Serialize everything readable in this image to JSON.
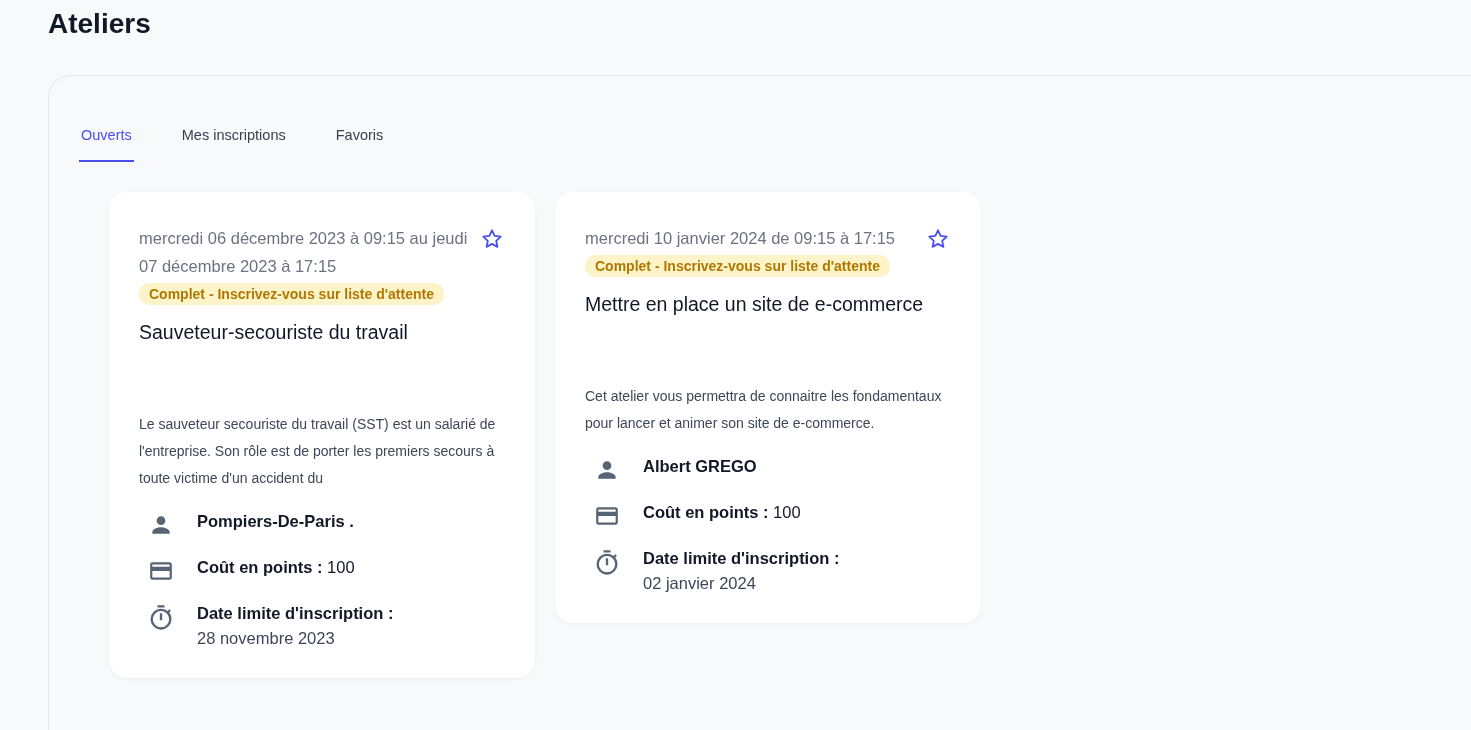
{
  "page_title": "Ateliers",
  "tabs": [
    {
      "label": "Ouverts",
      "selected": true
    },
    {
      "label": "Mes inscriptions",
      "selected": false
    },
    {
      "label": "Favoris",
      "selected": false
    }
  ],
  "workshops": [
    {
      "date": "mercredi 06 décembre 2023 à 09:15 au jeudi 07 décembre 2023 à 17:15",
      "favorite": false,
      "status": "Complet - Inscrivez-vous sur liste d'attente",
      "title": "Sauveteur-secouriste du travail",
      "description": "Le sauveteur secouriste du travail (SST) est un salarié de l'entreprise. Son rôle est de porter les premiers secours à toute victime d'un accident du",
      "organizer": "Pompiers-De-Paris .",
      "cost_label": "Coût en points :",
      "cost_value": "100",
      "deadline_label": "Date limite d'inscription :",
      "deadline_value": "28 novembre 2023"
    },
    {
      "date": "mercredi 10 janvier 2024 de 09:15 à 17:15",
      "favorite": false,
      "status": "Complet - Inscrivez-vous sur liste d'attente",
      "title": "Mettre en place un site de e-commerce",
      "description": "Cet atelier vous permettra de connaitre les fondamentaux pour lancer et animer son site de e-commerce.",
      "organizer": "Albert GREGO",
      "cost_label": "Coût en points :",
      "cost_value": "100",
      "deadline_label": "Date limite d'inscription :",
      "deadline_value": "02 janvier 2024"
    }
  ]
}
